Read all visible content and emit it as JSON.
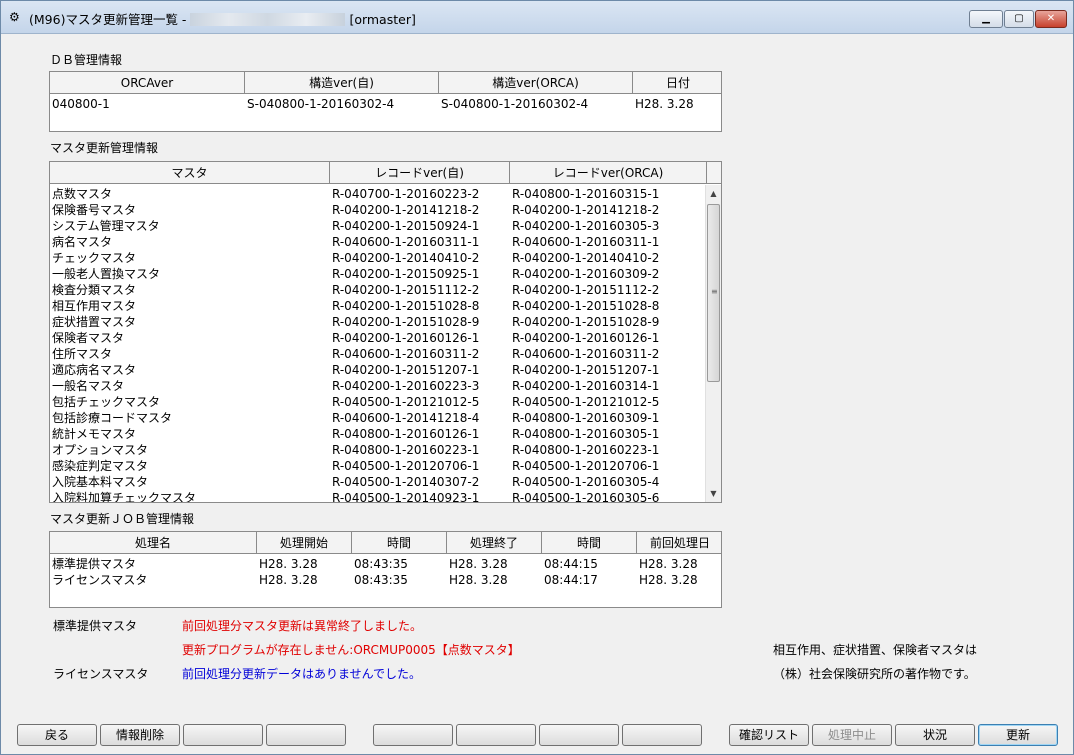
{
  "window": {
    "title_prefix": "(M96)マスタ更新管理一覧 -",
    "title_suffix": "[ormaster]",
    "minimize": "▁",
    "maximize": "▢",
    "close": "✕"
  },
  "db_info": {
    "label": "ＤＢ管理情報",
    "headers": [
      "ORCAver",
      "構造ver(自)",
      "構造ver(ORCA)",
      "日付"
    ],
    "rows": [
      [
        "040800-1",
        "S-040800-1-20160302-4",
        "S-040800-1-20160302-4",
        "H28. 3.28"
      ]
    ]
  },
  "master_info": {
    "label": "マスタ更新管理情報",
    "headers": [
      "マスタ",
      "レコードver(自)",
      "レコードver(ORCA)"
    ],
    "rows": [
      [
        "点数マスタ",
        "R-040700-1-20160223-2",
        "R-040800-1-20160315-1"
      ],
      [
        "保険番号マスタ",
        "R-040200-1-20141218-2",
        "R-040200-1-20141218-2"
      ],
      [
        "システム管理マスタ",
        "R-040200-1-20150924-1",
        "R-040200-1-20160305-3"
      ],
      [
        "病名マスタ",
        "R-040600-1-20160311-1",
        "R-040600-1-20160311-1"
      ],
      [
        "チェックマスタ",
        "R-040200-1-20140410-2",
        "R-040200-1-20140410-2"
      ],
      [
        "一般老人置換マスタ",
        "R-040200-1-20150925-1",
        "R-040200-1-20160309-2"
      ],
      [
        "検査分類マスタ",
        "R-040200-1-20151112-2",
        "R-040200-1-20151112-2"
      ],
      [
        "相互作用マスタ",
        "R-040200-1-20151028-8",
        "R-040200-1-20151028-8"
      ],
      [
        "症状措置マスタ",
        "R-040200-1-20151028-9",
        "R-040200-1-20151028-9"
      ],
      [
        "保険者マスタ",
        "R-040200-1-20160126-1",
        "R-040200-1-20160126-1"
      ],
      [
        "住所マスタ",
        "R-040600-1-20160311-2",
        "R-040600-1-20160311-2"
      ],
      [
        "適応病名マスタ",
        "R-040200-1-20151207-1",
        "R-040200-1-20151207-1"
      ],
      [
        "一般名マスタ",
        "R-040200-1-20160223-3",
        "R-040200-1-20160314-1"
      ],
      [
        "包括チェックマスタ",
        "R-040500-1-20121012-5",
        "R-040500-1-20121012-5"
      ],
      [
        "包括診療コードマスタ",
        "R-040600-1-20141218-4",
        "R-040800-1-20160309-1"
      ],
      [
        "統計メモマスタ",
        "R-040800-1-20160126-1",
        "R-040800-1-20160305-1"
      ],
      [
        "オプションマスタ",
        "R-040800-1-20160223-1",
        "R-040800-1-20160223-1"
      ],
      [
        "感染症判定マスタ",
        "R-040500-1-20120706-1",
        "R-040500-1-20120706-1"
      ],
      [
        "入院基本料マスタ",
        "R-040500-1-20140307-2",
        "R-040500-1-20160305-4"
      ],
      [
        "入院料加算チェックマスタ",
        "R-040500-1-20140923-1",
        "R-040500-1-20160305-6"
      ]
    ],
    "scroll_up": "▲",
    "scroll_down": "▼",
    "scroll_grip": "≡"
  },
  "job_info": {
    "label": "マスタ更新ＪＯＢ管理情報",
    "headers": [
      "処理名",
      "処理開始",
      "時間",
      "処理終了",
      "時間",
      "前回処理日"
    ],
    "rows": [
      [
        "標準提供マスタ",
        "H28. 3.28",
        "08:43:35",
        "H28. 3.28",
        "08:44:15",
        "H28. 3.28"
      ],
      [
        "ライセンスマスタ",
        "H28. 3.28",
        "08:43:35",
        "H28. 3.28",
        "08:44:17",
        "H28. 3.28"
      ]
    ]
  },
  "messages": {
    "standard_label": "標準提供マスタ",
    "standard_msg1": "前回処理分マスタ更新は異常終了しました。",
    "standard_msg2": "更新プログラムが存在しません:ORCMUP0005【点数マスタ】",
    "license_label": "ライセンスマスタ",
    "license_msg": "前回処理分更新データはありませんでした。",
    "copyright1": "相互作用、症状措置、保険者マスタは",
    "copyright2": "（株）社会保険研究所の著作物です。"
  },
  "buttons": {
    "back": "戻る",
    "delete_info": "情報削除",
    "f3": "",
    "f4": "",
    "f5": "",
    "f6": "",
    "f7": "",
    "f8": "",
    "confirm_list": "確認リスト",
    "cancel_process": "処理中止",
    "status": "状況",
    "update": "更新"
  },
  "colors": {
    "error_text": "#e00000",
    "info_text": "#0000d8"
  }
}
